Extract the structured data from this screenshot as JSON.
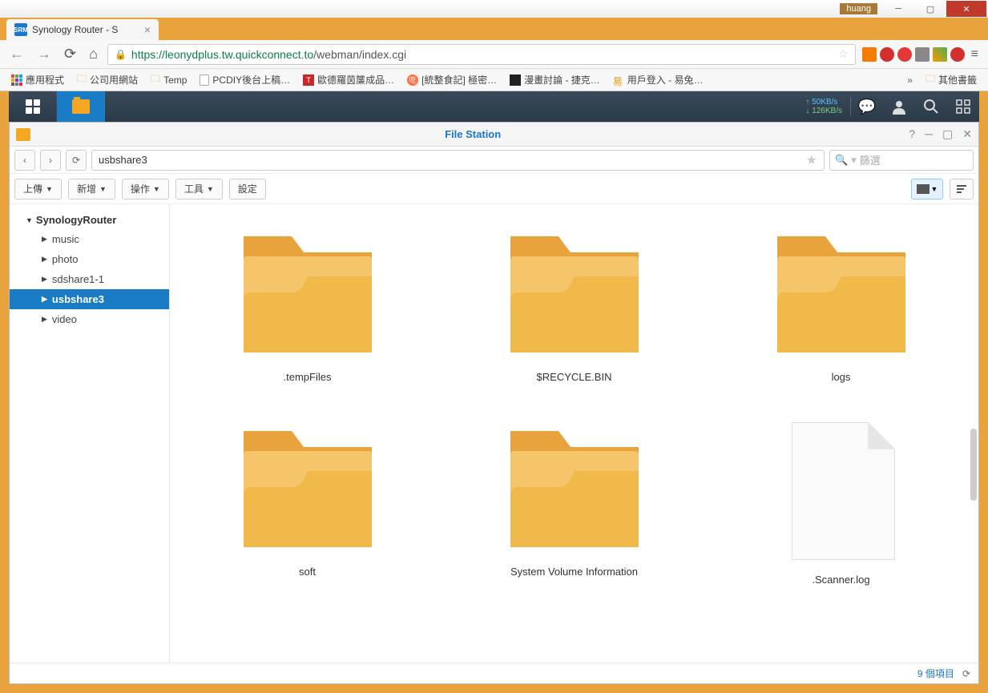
{
  "window": {
    "user": "huang"
  },
  "browser": {
    "tab_title": "Synology Router - S",
    "url_host": "https://leonydplus.tw.quickconnect.to",
    "url_path": "/webman/index.cgi",
    "bookmarks": {
      "apps_grid": "應用程式",
      "items": [
        {
          "type": "folder",
          "label": "公司用網站"
        },
        {
          "type": "folder",
          "label": "Temp"
        },
        {
          "type": "page",
          "label": "PCDIY後台上稿…"
        },
        {
          "type": "favt",
          "label": "歐德羅茵簾成品…"
        },
        {
          "type": "faveat",
          "label": "[統整食記] 極密…"
        },
        {
          "type": "favdark",
          "label": "漫畫討論 - 捷克…"
        },
        {
          "type": "favorange",
          "label": "用戶登入 - 易兔…"
        }
      ],
      "other": "其他書籤"
    }
  },
  "srm": {
    "net_up": "50KB/s",
    "net_down": "126KB/s"
  },
  "filestation": {
    "title": "File Station",
    "path": "usbshare3",
    "filter_placeholder": "篩選",
    "actions": {
      "upload": "上傳",
      "new": "新增",
      "action": "操作",
      "tools": "工具",
      "settings": "設定"
    },
    "tree": {
      "root": "SynologyRouter",
      "items": [
        {
          "label": "music"
        },
        {
          "label": "photo"
        },
        {
          "label": "sdshare1-1"
        },
        {
          "label": "usbshare3",
          "selected": true
        },
        {
          "label": "video"
        }
      ]
    },
    "files": [
      {
        "name": ".tempFiles",
        "type": "folder"
      },
      {
        "name": "$RECYCLE.BIN",
        "type": "folder"
      },
      {
        "name": "logs",
        "type": "folder"
      },
      {
        "name": "soft",
        "type": "folder"
      },
      {
        "name": "System Volume Information",
        "type": "folder"
      },
      {
        "name": ".Scanner.log",
        "type": "file"
      }
    ],
    "status_count": "9 個項目"
  }
}
